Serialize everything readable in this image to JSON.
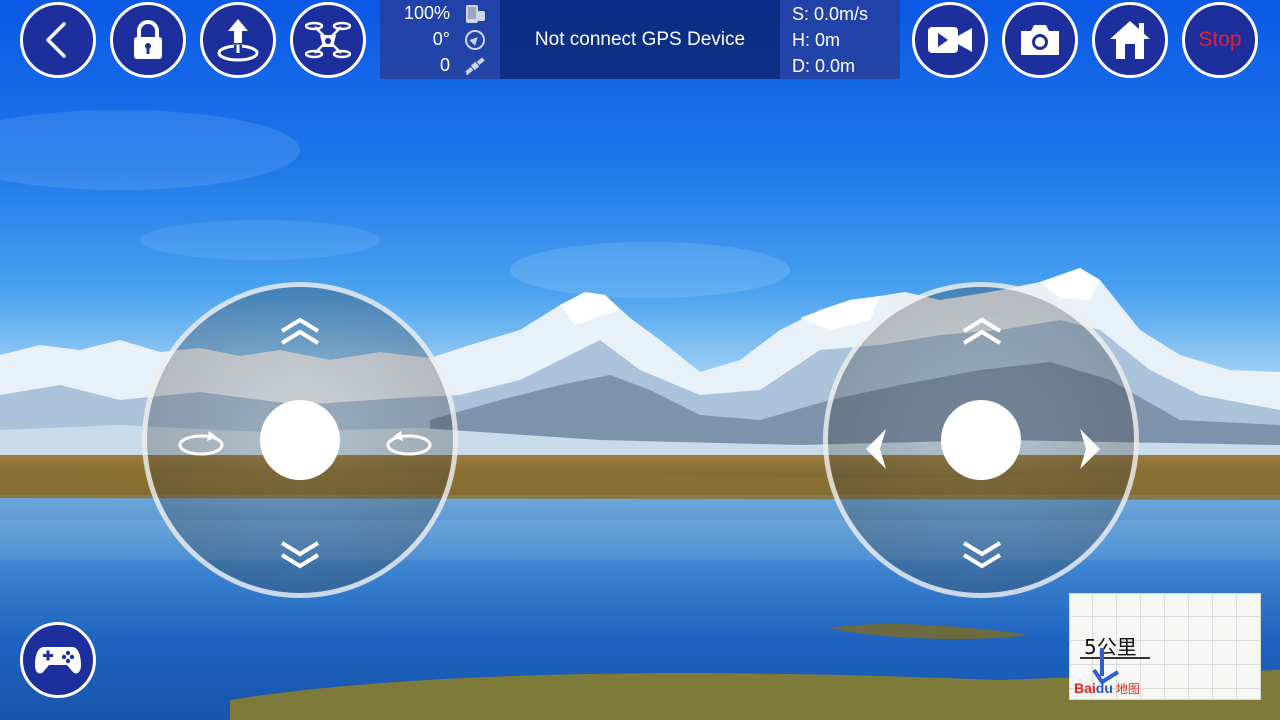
{
  "topbar": {
    "left_buttons": [
      "back",
      "lock",
      "takeoff",
      "drone"
    ],
    "right_buttons": [
      "record-video",
      "take-photo",
      "home",
      "stop"
    ],
    "stop_label": "Stop"
  },
  "status": {
    "battery": "100%",
    "heading": "0°",
    "satellites": "0",
    "gps_message": "Not connect GPS Device",
    "speed": "S: 0.0m/s",
    "height": "H: 0m",
    "distance": "D: 0.0m"
  },
  "map": {
    "scale": "5公里",
    "logo_bai": "Bai",
    "logo_du": "du",
    "logo_ditu": "地图"
  },
  "colors": {
    "button_fill": "#1d2f9c",
    "button_border": "#ffffff",
    "stop_text": "#e0203a",
    "status_panel": "#283c96",
    "gps_panel": "#0c2876"
  }
}
